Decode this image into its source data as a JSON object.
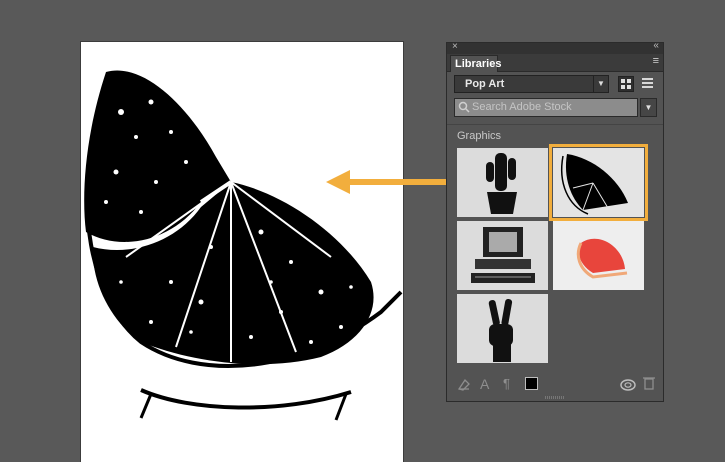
{
  "panel": {
    "tab_label": "Libraries",
    "close_glyph": "×",
    "collapse_glyph": "‹‹",
    "menu_glyph": "≡",
    "library_name": "Pop Art",
    "search_placeholder": "Search Adobe Stock",
    "section_title": "Graphics",
    "thumbnails": [
      {
        "name": "cactus",
        "selected": false
      },
      {
        "name": "grapefruit-slice-bw",
        "selected": true
      },
      {
        "name": "retro-computer",
        "selected": false
      },
      {
        "name": "grapefruit-photo",
        "selected": false
      },
      {
        "name": "peace-hand",
        "selected": false
      }
    ],
    "footer": {
      "text_style_glyph": "A",
      "paragraph_glyph": "¶"
    }
  },
  "colors": {
    "canvas_bg": "#595959",
    "panel_bg": "#535353",
    "highlight": "#F2AE3D"
  }
}
